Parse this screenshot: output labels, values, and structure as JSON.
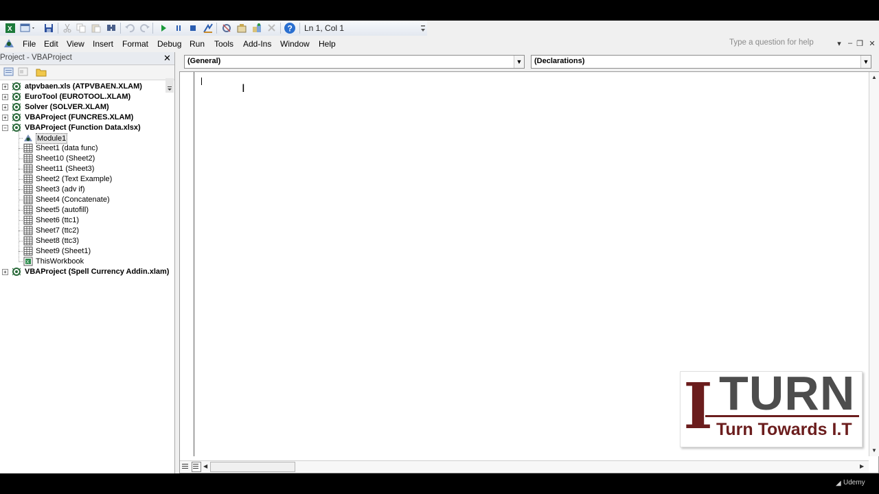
{
  "toolbar": {
    "position_readout": "Ln 1, Col 1",
    "icons": [
      "excel-view-icon",
      "insert-userform-icon",
      "save-icon",
      "cut-icon",
      "copy-icon",
      "paste-icon",
      "find-icon",
      "undo-icon",
      "redo-icon",
      "run-icon",
      "break-icon",
      "reset-icon",
      "design-mode-icon",
      "project-explorer-icon",
      "properties-icon",
      "object-browser-icon",
      "toolbox-icon",
      "help-icon"
    ]
  },
  "menubar": {
    "items": [
      {
        "label": "File"
      },
      {
        "label": "Edit"
      },
      {
        "label": "View"
      },
      {
        "label": "Insert"
      },
      {
        "label": "Format"
      },
      {
        "label": "Debug"
      },
      {
        "label": "Run"
      },
      {
        "label": "Tools"
      },
      {
        "label": "Add-Ins"
      },
      {
        "label": "Window"
      },
      {
        "label": "Help"
      }
    ],
    "help_placeholder": "Type a question for help",
    "window_buttons": [
      "▾",
      "–",
      "❐",
      "✕"
    ]
  },
  "project_explorer": {
    "title": "Project - VBAProject",
    "tree": [
      {
        "label": "atpvbaen.xls (ATPVBAEN.XLAM)",
        "level": 0,
        "kind": "project",
        "expander": "+"
      },
      {
        "label": "EuroTool (EUROTOOL.XLAM)",
        "level": 0,
        "kind": "project",
        "expander": "+"
      },
      {
        "label": "Solver (SOLVER.XLAM)",
        "level": 0,
        "kind": "project",
        "expander": "+"
      },
      {
        "label": "VBAProject (FUNCRES.XLAM)",
        "level": 0,
        "kind": "project",
        "expander": "+"
      },
      {
        "label": "VBAProject (Function Data.xlsx)",
        "level": 0,
        "kind": "project",
        "expander": "−"
      },
      {
        "label": "Module1",
        "level": 1,
        "kind": "module",
        "selected": true
      },
      {
        "label": "Sheet1 (data func)",
        "level": 1,
        "kind": "sheet"
      },
      {
        "label": "Sheet10 (Sheet2)",
        "level": 1,
        "kind": "sheet"
      },
      {
        "label": "Sheet11 (Sheet3)",
        "level": 1,
        "kind": "sheet"
      },
      {
        "label": "Sheet2 (Text Example)",
        "level": 1,
        "kind": "sheet"
      },
      {
        "label": "Sheet3 (adv if)",
        "level": 1,
        "kind": "sheet"
      },
      {
        "label": "Sheet4 (Concatenate)",
        "level": 1,
        "kind": "sheet"
      },
      {
        "label": "Sheet5 (autofill)",
        "level": 1,
        "kind": "sheet"
      },
      {
        "label": "Sheet6 (ttc1)",
        "level": 1,
        "kind": "sheet"
      },
      {
        "label": "Sheet7 (ttc2)",
        "level": 1,
        "kind": "sheet"
      },
      {
        "label": "Sheet8 (ttc3)",
        "level": 1,
        "kind": "sheet"
      },
      {
        "label": "Sheet9 (Sheet1)",
        "level": 1,
        "kind": "sheet"
      },
      {
        "label": "ThisWorkbook",
        "level": 1,
        "kind": "workbook"
      },
      {
        "label": "VBAProject (Spell Currency Addin.xlam)",
        "level": 0,
        "kind": "project",
        "expander": "+"
      }
    ]
  },
  "code_window": {
    "object_combo": "(General)",
    "procedure_combo": "(Declarations)",
    "code_text": ""
  },
  "logo": {
    "big_letter": "I",
    "word": "TURN",
    "tagline": "Turn Towards I.T"
  },
  "watermark": {
    "brand": "Udemy"
  },
  "colors": {
    "logo_red": "#6b1d1d",
    "logo_gray": "#4d4d4d",
    "panel_bg": "#f0f0f0"
  }
}
